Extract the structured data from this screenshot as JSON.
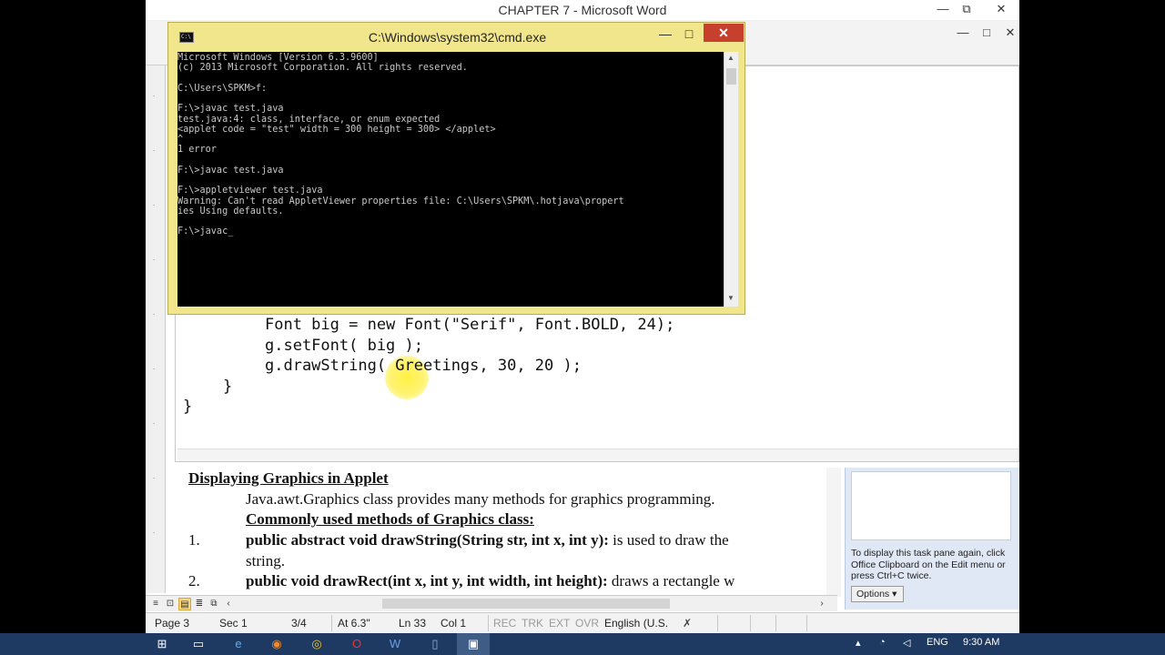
{
  "word": {
    "title": "CHAPTER 7 - Microsoft Word",
    "minimize": "—",
    "restore": "⧉",
    "close": "✕",
    "inner_minimize": "—",
    "inner_restore": "□",
    "inner_close": "✕"
  },
  "code_lines": [
    "Font big = new Font(\"Serif\", Font.BOLD, 24);",
    "g.setFont( big );",
    "g.drawString( Greetings, 30, 20 );",
    "}",
    "}"
  ],
  "document": {
    "heading": "Displaying Graphics in Applet",
    "intro_link": "Java.awt.Graphics",
    "intro_rest": " class provides many methods for graphics programming.",
    "subheading": "Commonly used methods of Graphics class:",
    "items": [
      {
        "num": "1.",
        "sig": "public abstract void drawString(String str, int x, int y):",
        "desc": " is used to draw the",
        "cont": "string."
      },
      {
        "num": "2.",
        "sig": "public void drawRect(int x, int y, int width, int height):",
        "desc": " draws a rectangle w"
      }
    ]
  },
  "task_pane": {
    "message": "To display this task pane again, click Office Clipboard on the Edit menu or press Ctrl+C twice.",
    "options_label": "Options ▾"
  },
  "statusbar": {
    "page": "Page 3",
    "section": "Sec 1",
    "page_of": "3/4",
    "at": "At 6.3\"",
    "ln": "Ln 33",
    "col": "Col 1",
    "rec": "REC",
    "trk": "TRK",
    "ext": "EXT",
    "ovr": "OVR",
    "language": "English (U.S."
  },
  "cmd": {
    "title": "C:\\Windows\\system32\\cmd.exe",
    "icon_text": "C:\\",
    "minimize": "—",
    "restore": "□",
    "close": "✕",
    "console_lines": [
      "Microsoft Windows [Version 6.3.9600]",
      "(c) 2013 Microsoft Corporation. All rights reserved.",
      "",
      "C:\\Users\\SPKM>f:",
      "",
      "F:\\>javac test.java",
      "test.java:4: class, interface, or enum expected",
      "<applet code = \"test\" width = 300 height = 300> </applet>",
      "^",
      "1 error",
      "",
      "F:\\>javac test.java",
      "",
      "F:\\>appletviewer test.java",
      "Warning: Can't read AppletViewer properties file: C:\\Users\\SPKM\\.hotjava\\propert",
      "ies Using defaults.",
      "",
      "F:\\>javac_"
    ]
  },
  "taskbar": {
    "tray_lang": "ENG",
    "time": "9:30 AM",
    "apps": [
      "start-icon",
      "file-explorer-icon",
      "internet-explorer-icon",
      "firefox-icon",
      "chrome-icon",
      "opera-icon",
      "word-icon",
      "notepad-icon",
      "cmd-icon"
    ]
  },
  "colors": {
    "cmd_frame": "#f2e68d",
    "cmd_close": "#c7402e",
    "taskbar": "#1e3a63",
    "console_bg": "#000000",
    "console_text": "#c8c8c8",
    "cursor_highlight": "#fff03c"
  }
}
